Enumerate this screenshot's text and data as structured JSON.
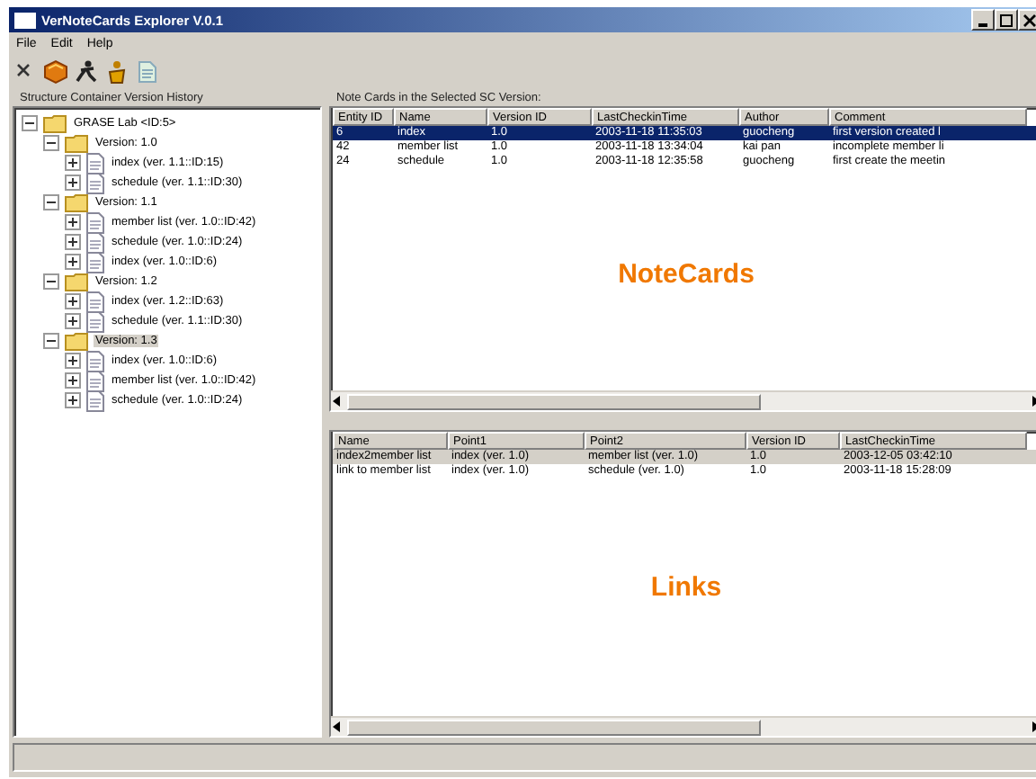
{
  "window": {
    "title": "VerNoteCards Explorer V.0.1"
  },
  "menu": [
    "File",
    "Edit",
    "Help"
  ],
  "history": {
    "title": "Structure Container Version History",
    "tree": [
      {
        "label": "GRASE Lab <ID:5>",
        "kind": "folder",
        "expanded": true,
        "selected": false,
        "children": [
          {
            "label": "Version: 1.0",
            "kind": "folder",
            "expanded": true,
            "selected": false,
            "children": [
              {
                "label": "index (ver. 1.1::ID:15)",
                "kind": "card",
                "expanded": false,
                "selected": false
              },
              {
                "label": "schedule (ver. 1.1::ID:30)",
                "kind": "card",
                "expanded": false,
                "selected": false
              }
            ]
          },
          {
            "label": "Version: 1.1",
            "kind": "folder",
            "expanded": true,
            "selected": false,
            "children": [
              {
                "label": "member list (ver. 1.0::ID:42)",
                "kind": "card",
                "expanded": false,
                "selected": false
              },
              {
                "label": "schedule (ver. 1.0::ID:24)",
                "kind": "card",
                "expanded": false,
                "selected": false
              },
              {
                "label": "index (ver. 1.0::ID:6)",
                "kind": "card",
                "expanded": false,
                "selected": false
              }
            ]
          },
          {
            "label": "Version: 1.2",
            "kind": "folder",
            "expanded": true,
            "selected": false,
            "children": [
              {
                "label": "index (ver. 1.2::ID:63)",
                "kind": "card",
                "expanded": false,
                "selected": false
              },
              {
                "label": "schedule (ver. 1.1::ID:30)",
                "kind": "card",
                "expanded": false,
                "selected": false
              }
            ]
          },
          {
            "label": "Version: 1.3",
            "kind": "folder",
            "expanded": true,
            "selected": true,
            "children": [
              {
                "label": "index (ver. 1.0::ID:6)",
                "kind": "card",
                "expanded": false,
                "selected": false
              },
              {
                "label": "member list (ver. 1.0::ID:42)",
                "kind": "card",
                "expanded": false,
                "selected": false
              },
              {
                "label": "schedule (ver. 1.0::ID:24)",
                "kind": "card",
                "expanded": false,
                "selected": false
              }
            ]
          }
        ]
      }
    ]
  },
  "notecards": {
    "title": "Note Cards in the Selected SC Version:",
    "caption": "NoteCards",
    "columns": [
      "Entity ID",
      "Name",
      "Version ID",
      "LastCheckinTime",
      "Author",
      "Comment"
    ],
    "rows": [
      {
        "cells": [
          "6",
          "index",
          "1.0",
          "2003-11-18 11:35:03",
          "guocheng",
          "first version created l"
        ],
        "selected": true
      },
      {
        "cells": [
          "42",
          "member list",
          "1.0",
          "2003-11-18 13:34:04",
          "kai pan",
          "incomplete member li"
        ],
        "selected": false
      },
      {
        "cells": [
          "24",
          "schedule",
          "1.0",
          "2003-11-18 12:35:58",
          "guocheng",
          "first create the meetin"
        ],
        "selected": false
      }
    ]
  },
  "links": {
    "caption": "Links",
    "columns": [
      "Name",
      "Point1",
      "Point2",
      "Version ID",
      "LastCheckinTime"
    ],
    "rows": [
      {
        "cells": [
          "index2member list",
          "index (ver. 1.0)",
          "member list (ver. 1.0)",
          "1.0",
          "2003-12-05 03:42:10"
        ],
        "selected": true
      },
      {
        "cells": [
          "link to member list",
          "index (ver. 1.0)",
          "schedule (ver. 1.0)",
          "1.0",
          "2003-11-18 15:28:09"
        ],
        "selected": false
      }
    ]
  }
}
